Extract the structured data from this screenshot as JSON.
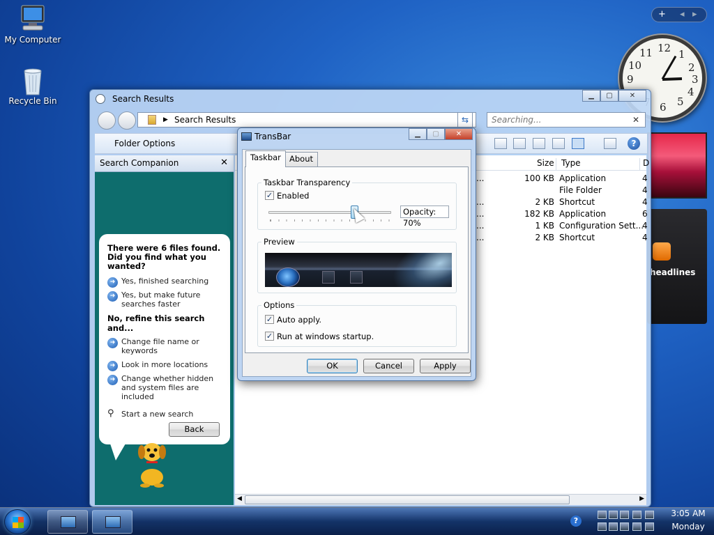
{
  "desktop": {
    "icons": [
      {
        "label": "My Computer"
      },
      {
        "label": "Recycle Bin"
      }
    ]
  },
  "gadgets": {
    "bar_symbols": {
      "add": "+",
      "prev": "◂",
      "next": "▸"
    },
    "clock": {
      "numbers": [
        "12",
        "1",
        "2",
        "3",
        "4",
        "5",
        "6",
        "7",
        "8",
        "9",
        "10",
        "11"
      ],
      "time": "3:05"
    },
    "feed_text": "headlines"
  },
  "explorer": {
    "title": "Search Results",
    "address": "Search Results",
    "search_placeholder": "Searching...",
    "toolbar": {
      "folder_options": "Folder Options"
    },
    "companion": {
      "header": "Search Companion",
      "close": "✕",
      "question": "There were 6 files found. Did you find what you wanted?",
      "options_yes": [
        "Yes, finished searching",
        "Yes, but make future searches faster"
      ],
      "refine_heading": "No, refine this search and...",
      "options_refine": [
        "Change file name or keywords",
        "Look in more locations",
        "Change whether hidden and system files are included"
      ],
      "new_search": "Start a new search",
      "back_button": "Back"
    },
    "columns": {
      "size": "Size",
      "type": "Type",
      "d": "D"
    },
    "rows": [
      {
        "dots": "...",
        "size": "100 KB",
        "type": "Application",
        "d": "4"
      },
      {
        "dots": "",
        "size": "",
        "type": "File Folder",
        "d": "4"
      },
      {
        "dots": "...",
        "size": "2 KB",
        "type": "Shortcut",
        "d": "4"
      },
      {
        "dots": "...",
        "size": "182 KB",
        "type": "Application",
        "d": "6"
      },
      {
        "dots": "...",
        "size": "1 KB",
        "type": "Configuration Sett...",
        "d": "4"
      },
      {
        "dots": "...",
        "size": "2 KB",
        "type": "Shortcut",
        "d": "4"
      }
    ]
  },
  "dialog": {
    "title": "TransBar",
    "tabs": [
      "Taskbar",
      "About"
    ],
    "transparency_group": "Taskbar Transparency",
    "enabled_label": "Enabled",
    "opacity_label": "Opacity: 70%",
    "opacity_value": 0.7,
    "preview_group": "Preview",
    "options_group": "Options",
    "auto_apply": "Auto apply.",
    "run_startup": "Run at windows startup.",
    "ok": "OK",
    "cancel": "Cancel",
    "apply": "Apply"
  },
  "taskbar": {
    "time": "3:05 AM",
    "day": "Monday"
  }
}
